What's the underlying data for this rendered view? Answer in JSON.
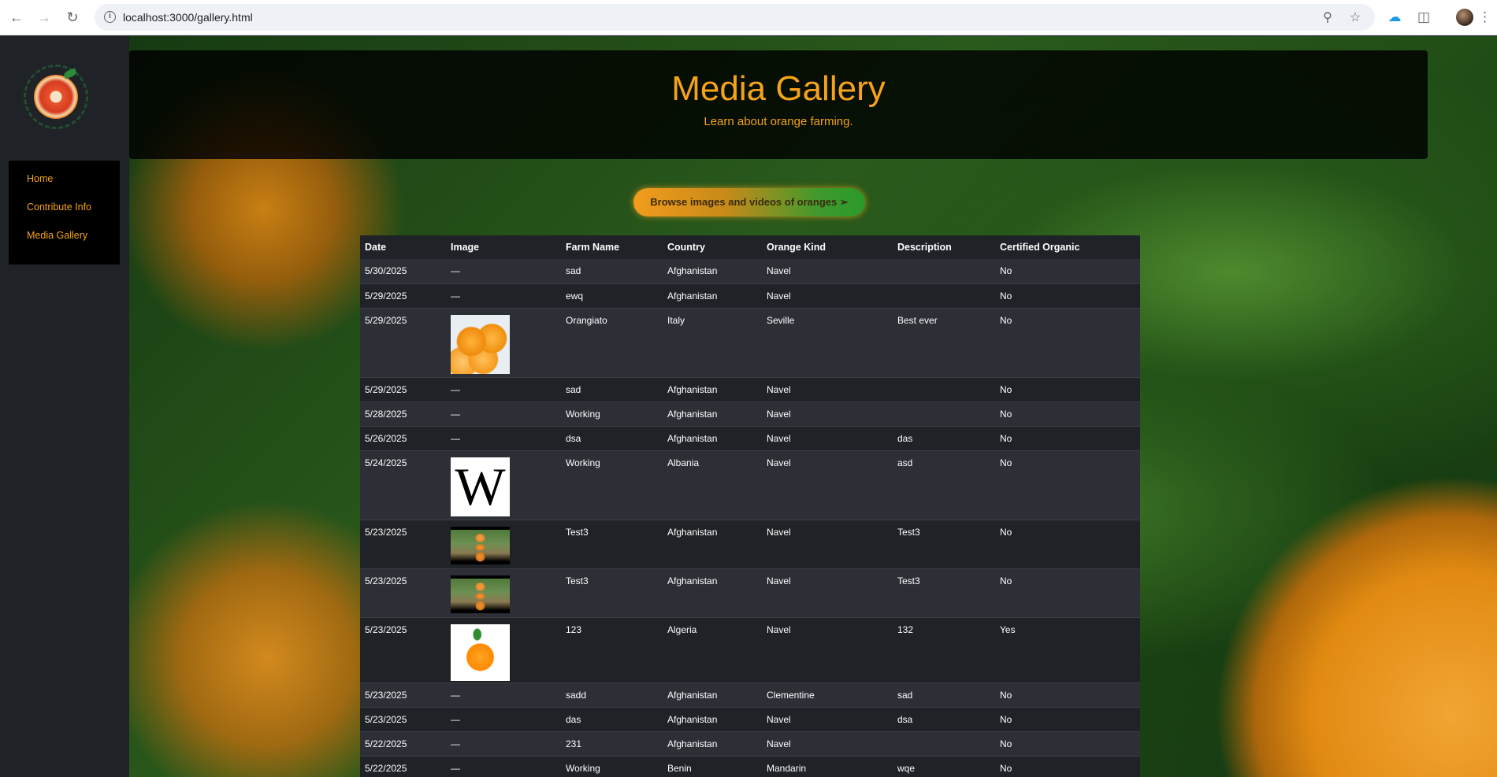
{
  "browser": {
    "url": "localhost:3000/gallery.html"
  },
  "sidebar": {
    "items": [
      {
        "label": "Home"
      },
      {
        "label": "Contribute Info"
      },
      {
        "label": "Media Gallery"
      }
    ]
  },
  "header": {
    "title": "Media Gallery",
    "subtitle": "Learn about orange farming."
  },
  "browse_button": "Browse images and videos of oranges ➢",
  "table": {
    "columns": [
      "Date",
      "Image",
      "Farm Name",
      "Country",
      "Orange Kind",
      "Description",
      "Certified Organic"
    ],
    "rows": [
      {
        "date": "5/30/2025",
        "image": "—",
        "farm": "sad",
        "country": "Afghanistan",
        "kind": "Navel",
        "desc": "",
        "organic": "No"
      },
      {
        "date": "5/29/2025",
        "image": "—",
        "farm": "ewq",
        "country": "Afghanistan",
        "kind": "Navel",
        "desc": "",
        "organic": "No"
      },
      {
        "date": "5/29/2025",
        "image": "oranges-photo",
        "farm": "Orangiato",
        "country": "Italy",
        "kind": "Seville",
        "desc": "Best ever",
        "organic": "No"
      },
      {
        "date": "5/29/2025",
        "image": "—",
        "farm": "sad",
        "country": "Afghanistan",
        "kind": "Navel",
        "desc": "",
        "organic": "No"
      },
      {
        "date": "5/28/2025",
        "image": "—",
        "farm": "Working",
        "country": "Afghanistan",
        "kind": "Navel",
        "desc": "",
        "organic": "No"
      },
      {
        "date": "5/26/2025",
        "image": "—",
        "farm": "dsa",
        "country": "Afghanistan",
        "kind": "Navel",
        "desc": "das",
        "organic": "No"
      },
      {
        "date": "5/24/2025",
        "image": "wikipedia-logo",
        "farm": "Working",
        "country": "Albania",
        "kind": "Navel",
        "desc": "asd",
        "organic": "No"
      },
      {
        "date": "5/23/2025",
        "image": "video-thumbnail",
        "farm": "Test3",
        "country": "Afghanistan",
        "kind": "Navel",
        "desc": "Test3",
        "organic": "No"
      },
      {
        "date": "5/23/2025",
        "image": "video-thumbnail",
        "farm": "Test3",
        "country": "Afghanistan",
        "kind": "Navel",
        "desc": "Test3",
        "organic": "No"
      },
      {
        "date": "5/23/2025",
        "image": "orange-photo",
        "farm": "123",
        "country": "Algeria",
        "kind": "Navel",
        "desc": "132",
        "organic": "Yes"
      },
      {
        "date": "5/23/2025",
        "image": "—",
        "farm": "sadd",
        "country": "Afghanistan",
        "kind": "Clementine",
        "desc": "sad",
        "organic": "No"
      },
      {
        "date": "5/23/2025",
        "image": "—",
        "farm": "das",
        "country": "Afghanistan",
        "kind": "Navel",
        "desc": "dsa",
        "organic": "No"
      },
      {
        "date": "5/22/2025",
        "image": "—",
        "farm": "231",
        "country": "Afghanistan",
        "kind": "Navel",
        "desc": "",
        "organic": "No"
      },
      {
        "date": "5/22/2025",
        "image": "—",
        "farm": "Working",
        "country": "Benin",
        "kind": "Mandarin",
        "desc": "wqe",
        "organic": "No"
      }
    ]
  },
  "thumb_labels": {
    "wiki": "W"
  }
}
